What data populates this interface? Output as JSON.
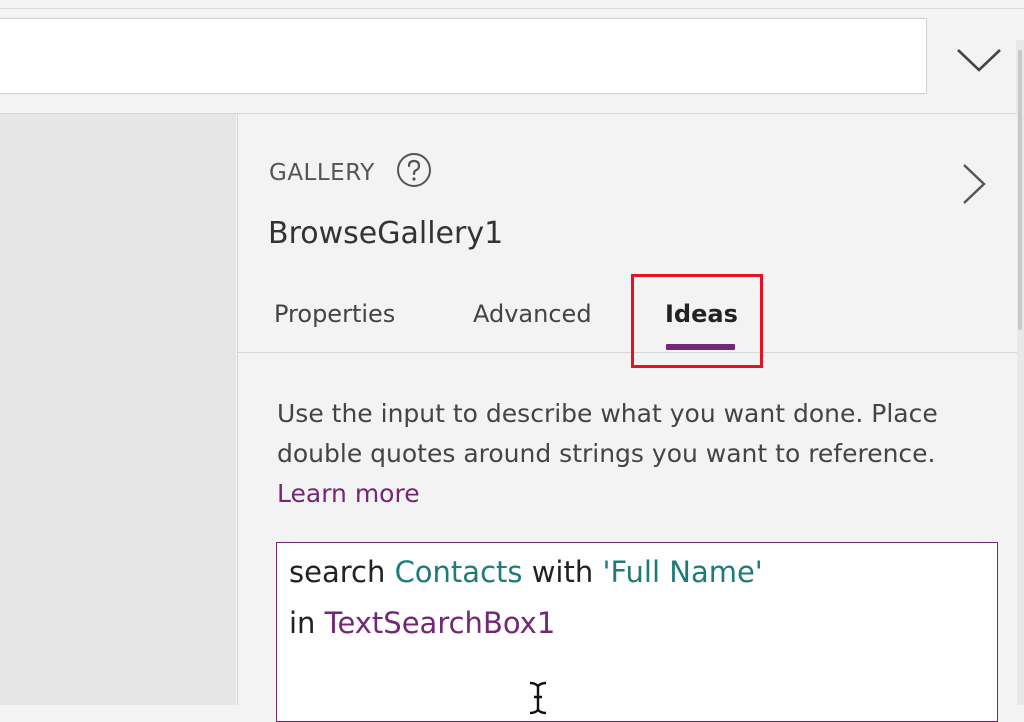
{
  "formula_bar": {
    "value": "",
    "expand_icon": "chevron-down-icon"
  },
  "panel": {
    "control_type": "GALLERY",
    "help_icon": "help-icon",
    "collapse_icon": "chevron-right-icon",
    "control_name": "BrowseGallery1",
    "tabs": [
      {
        "label": "Properties",
        "selected": false
      },
      {
        "label": "Advanced",
        "selected": false
      },
      {
        "label": "Ideas",
        "selected": true
      }
    ],
    "accent_color": "#742774",
    "highlight_color": "#e81123",
    "description": {
      "text": "Use the input to describe what you want done. Place double quotes around strings you want to reference.",
      "link": "Learn more"
    },
    "idea_input": {
      "line1": {
        "w1": "search",
        "w2": "Contacts",
        "w3": "with",
        "w4": "'Full Name'"
      },
      "line2": {
        "w1": "in",
        "w2": "TextSearchBox1"
      },
      "cursor_icon": "text-cursor-icon"
    }
  }
}
